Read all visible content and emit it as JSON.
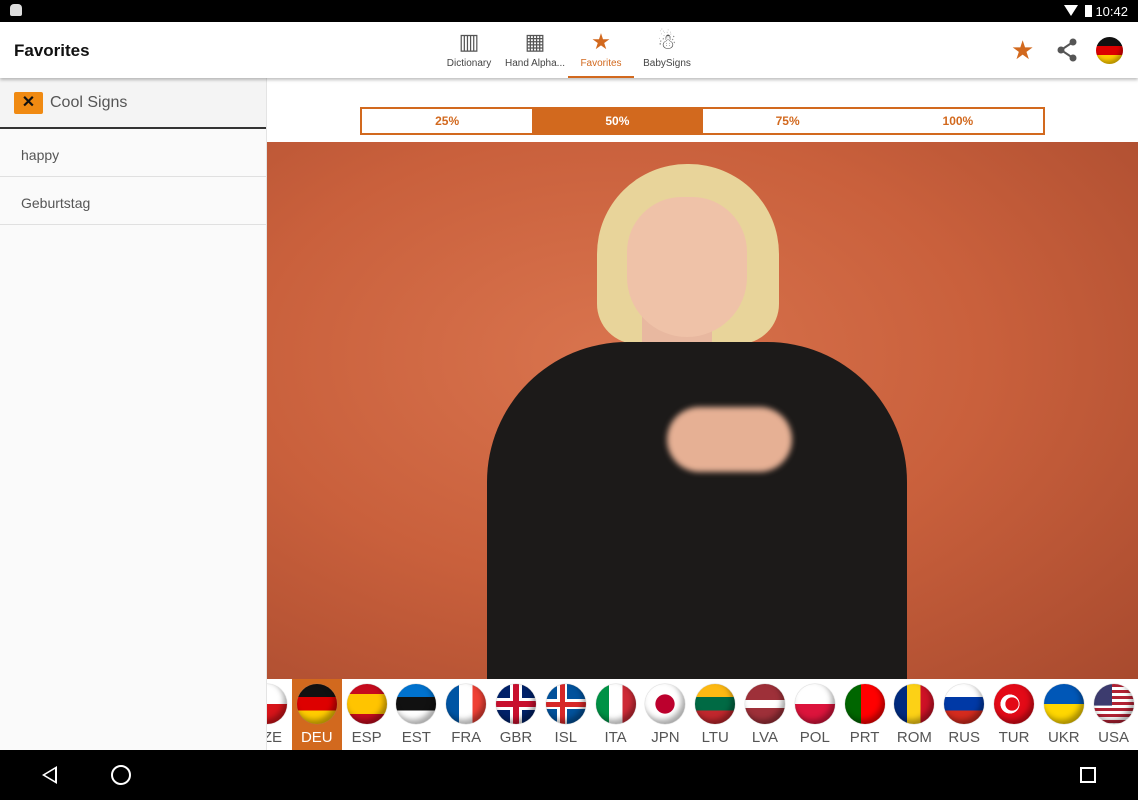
{
  "status": {
    "time": "10:42"
  },
  "appbar": {
    "title": "Favorites",
    "tabs": [
      {
        "label": "Dictionary",
        "icon": "book-icon"
      },
      {
        "label": "Hand Alpha...",
        "icon": "blocks-icon"
      },
      {
        "label": "Favorites",
        "icon": "star-icon",
        "active": true
      },
      {
        "label": "BabySigns",
        "icon": "baby-icon"
      }
    ]
  },
  "actions": [
    "star-icon",
    "share-icon",
    "germany-flag-icon"
  ],
  "sidebar": {
    "folder": "Cool Signs",
    "items": [
      "happy",
      "Geburtstag"
    ]
  },
  "speed": {
    "options": [
      "25%",
      "50%",
      "75%",
      "100%"
    ],
    "selected": "50%"
  },
  "languages": {
    "selected": "DEU",
    "items": [
      "CZE",
      "DEU",
      "ESP",
      "EST",
      "FRA",
      "GBR",
      "ISL",
      "ITA",
      "JPN",
      "LTU",
      "LVA",
      "POL",
      "PRT",
      "ROM",
      "RUS",
      "TUR",
      "UKR",
      "USA"
    ]
  },
  "accent": "#d2691e"
}
